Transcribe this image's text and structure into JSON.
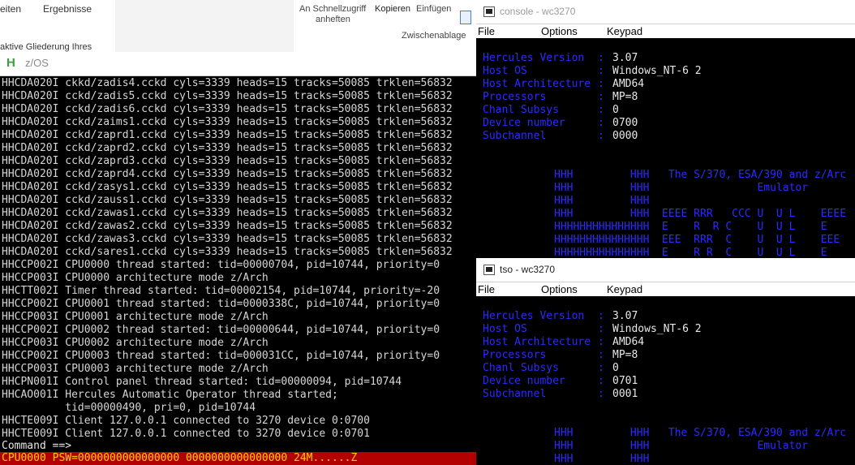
{
  "explorer": {
    "ribbon": {
      "tab_partial": "eiten",
      "tab_results": "Ergebnisse",
      "outline_text": "aktive Gliederung Ihres",
      "pin_line1": "An Schnellzugriff",
      "pin_line2": "anheften",
      "copy": "Kopieren",
      "paste": "Einfügen",
      "clipboard_group": "Zwischenablage",
      "clipboard_icon": "paste-icon"
    }
  },
  "zos": {
    "title": "z/OS",
    "icon": "hercules-icon",
    "lines": [
      "HHCDA020I ckkd/zadis4.cckd cyls=3339 heads=15 tracks=50085 trklen=56832",
      "HHCDA020I cckd/zadis5.cckd cyls=3339 heads=15 tracks=50085 trklen=56832",
      "HHCDA020I cckd/zadis6.cckd cyls=3339 heads=15 tracks=50085 trklen=56832",
      "HHCDA020I cckd/zaims1.cckd cyls=3339 heads=15 tracks=50085 trklen=56832",
      "HHCDA020I cckd/zaprd1.cckd cyls=3339 heads=15 tracks=50085 trklen=56832",
      "HHCDA020I cckd/zaprd2.cckd cyls=3339 heads=15 tracks=50085 trklen=56832",
      "HHCDA020I cckd/zaprd3.cckd cyls=3339 heads=15 tracks=50085 trklen=56832",
      "HHCDA020I cckd/zaprd4.cckd cyls=3339 heads=15 tracks=50085 trklen=56832",
      "HHCDA020I cckd/zasys1.cckd cyls=3339 heads=15 tracks=50085 trklen=56832",
      "HHCDA020I cckd/zauss1.cckd cyls=3339 heads=15 tracks=50085 trklen=56832",
      "HHCDA020I cckd/zawas1.cckd cyls=3339 heads=15 tracks=50085 trklen=56832",
      "HHCDA020I cckd/zawas2.cckd cyls=3339 heads=15 tracks=50085 trklen=56832",
      "HHCDA020I cckd/zawas3.cckd cyls=3339 heads=15 tracks=50085 trklen=56832",
      "HHCDA020I cckd/sares1.cckd cyls=3339 heads=15 tracks=50085 trklen=56832",
      "HHCCP002I CPU0000 thread started: tid=00000704, pid=10744, priority=0",
      "HHCCP003I CPU0000 architecture mode z/Arch",
      "HHCTT002I Timer thread started: tid=00002154, pid=10744, priority=-20",
      "HHCCP002I CPU0001 thread started: tid=0000338C, pid=10744, priority=0",
      "HHCCP003I CPU0001 architecture mode z/Arch",
      "HHCCP002I CPU0002 thread started: tid=00000644, pid=10744, priority=0",
      "HHCCP003I CPU0002 architecture mode z/Arch",
      "HHCCP002I CPU0003 thread started: tid=000031CC, pid=10744, priority=0",
      "HHCCP003I CPU0003 architecture mode z/Arch",
      "HHCPN001I Control panel thread started: tid=00000094, pid=10744",
      "HHCAO001I Hercules Automatic Operator thread started;",
      "          tid=00000490, pri=0, pid=10744",
      "HHCTE009I Client 127.0.0.1 connected to 3270 device 0:0700",
      "HHCTE009I Client 127.0.0.1 connected to 3270 device 0:0701"
    ],
    "command_prompt": "Command ==>",
    "status": "CPU0000 PSW=0000000000000000 0000000000000000 24M......Z",
    "colors": {
      "status_bg": "#b30000",
      "status_fg": "#ffd000"
    }
  },
  "console": {
    "title": "console - wc3270",
    "menu": [
      "File",
      "Options",
      "Keypad"
    ],
    "info": [
      {
        "label": "Hercules Version",
        "value": "3.07"
      },
      {
        "label": "Host OS",
        "value": "Windows_NT-6 2"
      },
      {
        "label": "Host Architecture",
        "value": "AMD64"
      },
      {
        "label": "Processors",
        "value": "MP=8"
      },
      {
        "label": "Chanl Subsys",
        "value": "0"
      },
      {
        "label": "Device number",
        "value": "0700"
      },
      {
        "label": "Subchannel",
        "value": "0000"
      }
    ],
    "logo": [
      "HHH         HHH   The S/370, ESA/390 and z/Arc",
      "HHH         HHH                 Emulator",
      "HHH         HHH",
      "HHH         HHH  EEEE RRR   CCC U  U L    EEEE",
      "HHHHHHHHHHHHHHH  E    R  R C    U  U L    E",
      "HHHHHHHHHHHHHHH  EEE  RRR  C    U  U L    EEE",
      "HHHHHHHHHHHHHHH  E    R R  C    U  U L    E"
    ]
  },
  "tso": {
    "title": "tso - wc3270",
    "menu": [
      "File",
      "Options",
      "Keypad"
    ],
    "info": [
      {
        "label": "Hercules Version",
        "value": "3.07"
      },
      {
        "label": "Host OS",
        "value": "Windows_NT-6 2"
      },
      {
        "label": "Host Architecture",
        "value": "AMD64"
      },
      {
        "label": "Processors",
        "value": "MP=8"
      },
      {
        "label": "Chanl Subsys",
        "value": "0"
      },
      {
        "label": "Device number",
        "value": "0701"
      },
      {
        "label": "Subchannel",
        "value": "0001"
      }
    ],
    "logo": [
      "HHH         HHH   The S/370, ESA/390 and z/Arc",
      "HHH         HHH                 Emulator",
      "HHH         HHH"
    ]
  },
  "colors": {
    "terminal_blue": "#2b2bff",
    "terminal_white": "#e8e8e8",
    "terminal_bg": "#000000"
  }
}
